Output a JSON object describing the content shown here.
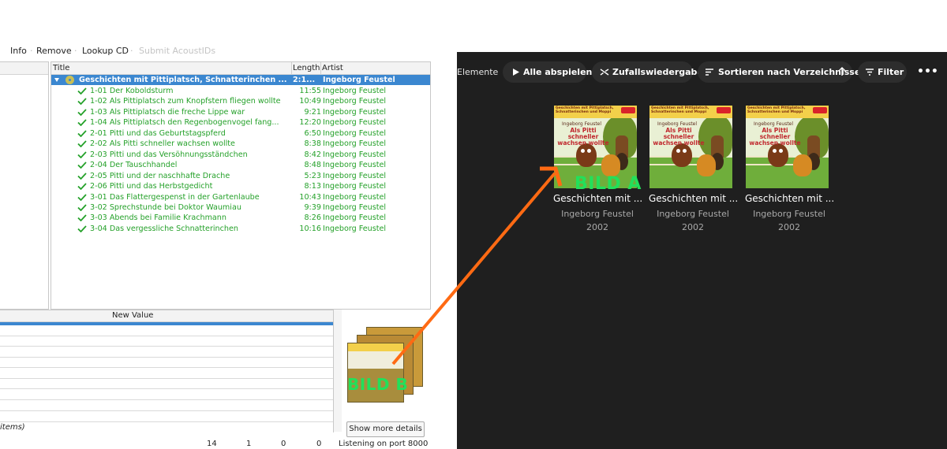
{
  "left_app": {
    "toolbar": {
      "items": [
        "Info",
        "Remove",
        "Lookup CD",
        "Submit AcoustIDs"
      ]
    },
    "album_view": {
      "columns": [
        "Title",
        "Length",
        "Artist"
      ],
      "album": {
        "title": "Geschichten mit Pittiplatsch, Schnatterinchen ...",
        "length": "2:1...",
        "artist": "Ingeborg Feustel"
      },
      "tracks": [
        {
          "title": "1-01  Der Koboldsturm",
          "length": "11:55",
          "artist": "Ingeborg Feustel"
        },
        {
          "title": "1-02  Als Pittiplatsch zum Knopfstern fliegen wollte",
          "length": "10:49",
          "artist": "Ingeborg Feustel"
        },
        {
          "title": "1-03  Als Pittiplatsch die freche Lippe war",
          "length": "9:21",
          "artist": "Ingeborg Feustel"
        },
        {
          "title": "1-04  Als Pittiplatsch den Regenbogenvogel fang...",
          "length": "12:20",
          "artist": "Ingeborg Feustel"
        },
        {
          "title": "2-01  Pitti und das Geburtstagspferd",
          "length": "6:50",
          "artist": "Ingeborg Feustel"
        },
        {
          "title": "2-02  Als Pitti schneller wachsen wollte",
          "length": "8:38",
          "artist": "Ingeborg Feustel"
        },
        {
          "title": "2-03  Pitti und das Versöhnungsständchen",
          "length": "8:42",
          "artist": "Ingeborg Feustel"
        },
        {
          "title": "2-04  Der Tauschhandel",
          "length": "8:48",
          "artist": "Ingeborg Feustel"
        },
        {
          "title": "2-05  Pitti und der naschhafte Drache",
          "length": "5:23",
          "artist": "Ingeborg Feustel"
        },
        {
          "title": "2-06  Pitti und das Herbstgedicht",
          "length": "8:13",
          "artist": "Ingeborg Feustel"
        },
        {
          "title": "3-01  Das Flattergespenst in der Gartenlaube",
          "length": "10:43",
          "artist": "Ingeborg Feustel"
        },
        {
          "title": "3-02  Sprechstunde bei Doktor Waumiau",
          "length": "9:39",
          "artist": "Ingeborg Feustel"
        },
        {
          "title": "3-03  Abends bei Familie Krachmann",
          "length": "8:26",
          "artist": "Ingeborg Feustel"
        },
        {
          "title": "3-04  Das vergessliche Schnatterinchen",
          "length": "10:16",
          "artist": "Ingeborg Feustel"
        }
      ]
    },
    "metadata": {
      "column_header": "New Value",
      "footer_text": "items)"
    },
    "show_more_label": "Show more details",
    "status": {
      "files": "14",
      "albums": "1",
      "pending": "0",
      "requests": "0",
      "listening": "Listening on port 8000"
    },
    "annotation_label": "BILD B"
  },
  "right_app": {
    "label": "Elemente",
    "chips": [
      "Alle abspielen",
      "Zufallswiedergabe",
      "Sortieren nach Verzeichnisse",
      "Filter"
    ],
    "more_label": "•••",
    "albums": [
      {
        "title": "Geschichten mit ...",
        "artist": "Ingeborg Feustel",
        "year": "2002"
      },
      {
        "title": "Geschichten mit ...",
        "artist": "Ingeborg Feustel",
        "year": "2002"
      },
      {
        "title": "Geschichten mit ...",
        "artist": "Ingeborg Feustel",
        "year": "2002"
      }
    ],
    "cover": {
      "band_text": "Geschichten mit Pittiplatsch, Schnatterinchen und Moppi",
      "author": "Ingeborg Feustel",
      "title": "Als Pitti schneller wachsen wollte"
    },
    "annotation_label": "BILD A"
  },
  "colors": {
    "selection_blue": "#3b87d0",
    "track_green": "#25a12a",
    "annotation_green": "#22e05a",
    "arrow_orange": "#ff6a13",
    "dark_bg": "#1f1f1f",
    "chip_bg": "#2d2d2d"
  }
}
